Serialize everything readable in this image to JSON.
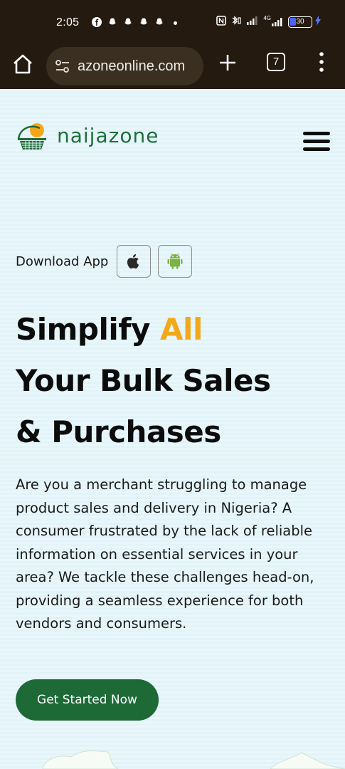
{
  "status_bar": {
    "time": "2:05",
    "battery": "30",
    "network": "4G"
  },
  "browser": {
    "url": "azoneonline.com",
    "tab_count": "7"
  },
  "site": {
    "logo_text": "naijazone",
    "download_label": "Download App",
    "headline": {
      "line1_a": "Simplify",
      "line1_b": "All",
      "line2": "Your Bulk Sales",
      "line3": "& Purchases"
    },
    "description": "Are you a merchant struggling to manage product sales and delivery in Nigeria? A consumer frustrated by the lack of reliable information on essential services in your area? We tackle these challenges head-on, providing a seamless experience for both vendors and consumers.",
    "cta_label": "Get Started Now"
  },
  "colors": {
    "brand_green": "#1d6a37",
    "accent_yellow": "#f3a81a",
    "toolbar_bg": "#241a10"
  },
  "icons": [
    "home-icon",
    "tune-icon",
    "plus-icon",
    "tabs-icon",
    "more-vert-icon",
    "hamburger-menu-icon",
    "apple-icon",
    "android-icon"
  ]
}
